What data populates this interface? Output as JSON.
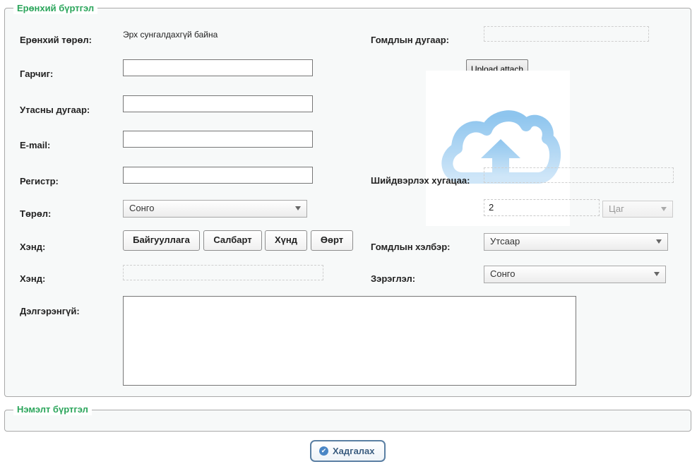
{
  "sections": {
    "general": {
      "legend": "Ерөнхий бүртгэл"
    },
    "additional": {
      "legend": "Нэмэлт бүртгэл"
    }
  },
  "left": {
    "general_type": {
      "label": "Ерөнхий төрөл:",
      "value": "Эрх сунгалдахгүй байна"
    },
    "title": {
      "label": "Гарчиг:",
      "value": ""
    },
    "phone": {
      "label": "Утасны дугаар:",
      "value": ""
    },
    "email": {
      "label": "E-mail:",
      "value": ""
    },
    "register": {
      "label": "Регистр:",
      "value": ""
    },
    "type": {
      "label": "Төрөл:",
      "selected": "Сонго"
    },
    "recipient": {
      "label": "Хэнд:",
      "options": [
        "Байгууллага",
        "Салбарт",
        "Хүнд",
        "Өөрт"
      ]
    },
    "recipient_detail": {
      "label": "Хэнд:",
      "value": ""
    },
    "details": {
      "label": "Дэлгэрэнгүй:",
      "value": ""
    }
  },
  "right": {
    "complaint_number": {
      "label": "Гомдлын дугаар:",
      "value": ""
    },
    "upload": {
      "label": "Upload.attach",
      "icon": "cloud-upload-icon"
    },
    "resolution_time": {
      "label": "Шийдвэрлэх хугацаа:",
      "value": "",
      "amount": "2",
      "unit": "Цаг"
    },
    "complaint_form": {
      "label": "Гомдлын хэлбэр:",
      "selected": "Утсаар"
    },
    "priority": {
      "label": "Зэрэглэл:",
      "selected": "Сонго"
    }
  },
  "actions": {
    "save": {
      "label": "Хадгалах",
      "icon": "check-circle-icon"
    }
  },
  "colors": {
    "legend": "#2ba55b",
    "save_border": "#5a7fa3",
    "cloud": "#8ec5ee"
  }
}
